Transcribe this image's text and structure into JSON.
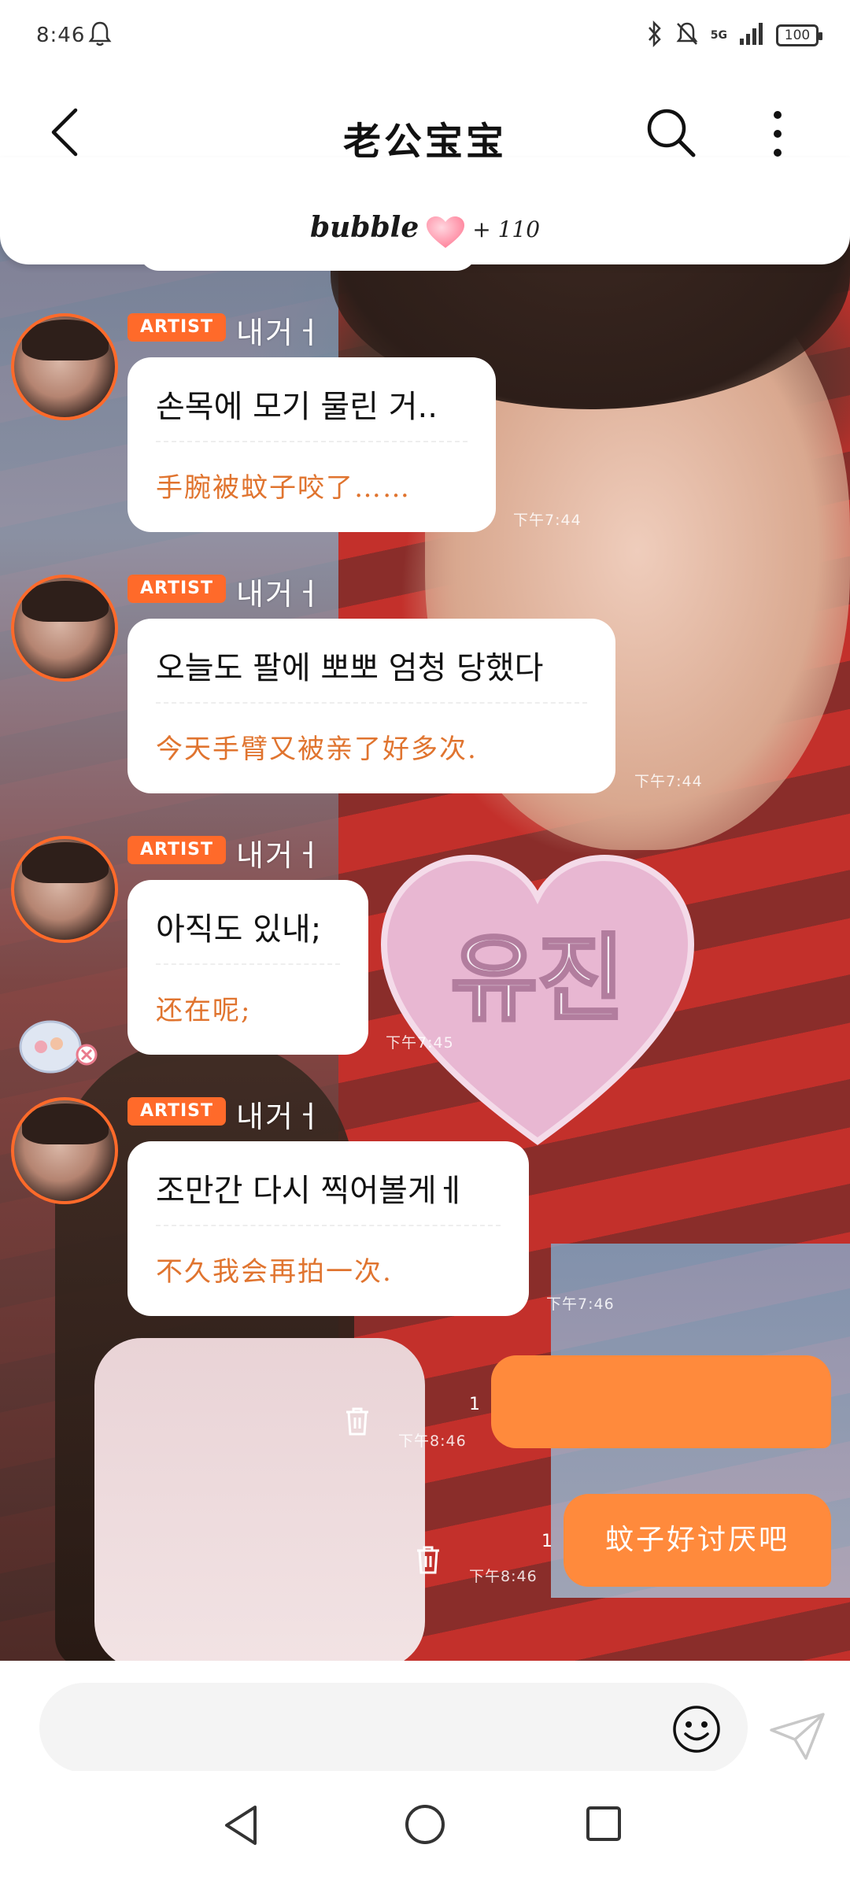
{
  "status_bar": {
    "time": "8:46",
    "network": "5G",
    "battery": "100"
  },
  "header": {
    "title": "老公宝宝"
  },
  "bubble_bar": {
    "brand": "bubble",
    "count": "+ 110"
  },
  "messages": [
    {
      "tag": "ARTIST",
      "sender": "내거ㅓ",
      "korean": "손목에 모기 물린 거..",
      "chinese": "手腕被蚊子咬了……",
      "time": "下午7:44"
    },
    {
      "tag": "ARTIST",
      "sender": "내거ㅓ",
      "korean": "오늘도 팔에 뽀뽀 엄청 당했다",
      "chinese": "今天手臂又被亲了好多次.",
      "time": "下午7:44"
    },
    {
      "tag": "ARTIST",
      "sender": "내거ㅓ",
      "korean": "아직도 있내;",
      "chinese": "还在呢;",
      "time": "下午7:45"
    },
    {
      "tag": "ARTIST",
      "sender": "내거ㅓ",
      "korean": "조만간 다시 찍어볼게ㅔ",
      "chinese": "不久我会再拍一次.",
      "time": "下午7:46"
    }
  ],
  "my_messages": [
    {
      "text": "",
      "read": "1",
      "time": "下午8:46"
    },
    {
      "text": "蚊子好讨厌吧",
      "read": "1",
      "time": "下午8:46"
    }
  ],
  "background": {
    "fan_text": "유진"
  },
  "input": {
    "placeholder": ""
  },
  "colors": {
    "accent": "#ff6a2a",
    "my_bubble": "#ff8a3c",
    "translation": "#e0742f"
  },
  "icons": [
    "back-arrow-icon",
    "search-icon",
    "more-vertical-icon",
    "heart-icon",
    "trash-icon",
    "emoji-icon",
    "send-icon",
    "nav-back-icon",
    "nav-home-icon",
    "nav-recent-icon",
    "bell-icon",
    "bluetooth-icon",
    "mute-icon",
    "signal-icon",
    "battery-icon"
  ]
}
